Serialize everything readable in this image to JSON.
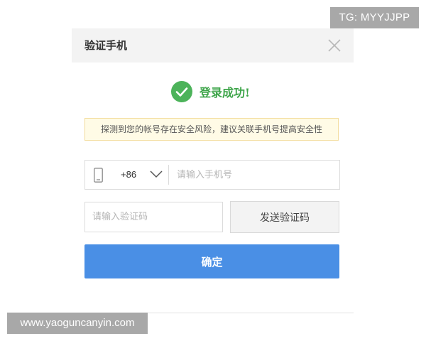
{
  "watermarks": {
    "top": "TG: MYYJJPP",
    "bottom": "www.yaoguncanyin.com"
  },
  "dialog": {
    "title": "验证手机",
    "close_icon": "close-icon",
    "success": {
      "icon": "check-circle-icon",
      "text": "登录成功!"
    },
    "notice": "探测到您的帐号存在安全风险，建议关联手机号提高安全性",
    "phone": {
      "icon": "mobile-phone-icon",
      "country_code": "+86",
      "dropdown_icon": "chevron-down-icon",
      "value": "",
      "placeholder": "请输入手机号"
    },
    "code": {
      "value": "",
      "placeholder": "请输入验证码",
      "send_label": "发送验证码"
    },
    "confirm_label": "确定"
  },
  "colors": {
    "success_green": "#3ea54a",
    "primary_blue": "#4a8fe5",
    "notice_bg": "#fffbe6",
    "notice_border": "#f3dc9c",
    "header_bg": "#f3f3f3"
  }
}
